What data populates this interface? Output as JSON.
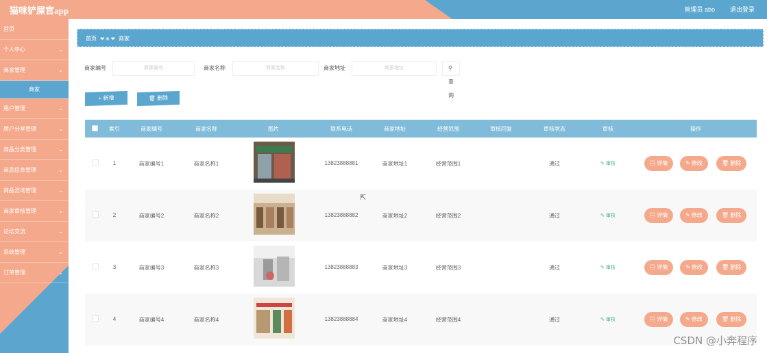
{
  "header": {
    "app_title": "猫咪铲屎官app",
    "user_info": "管理员 abo",
    "logout": "退出登录"
  },
  "sidebar": {
    "items": [
      {
        "label": "首页",
        "chevron": false
      },
      {
        "label": "个人中心",
        "chevron": true
      },
      {
        "label": "商家管理",
        "chevron": true
      },
      {
        "label": "商家",
        "sub": true
      },
      {
        "label": "用户管理",
        "chevron": true
      },
      {
        "label": "用户分享管理",
        "chevron": true
      },
      {
        "label": "商品分类管理",
        "chevron": true
      },
      {
        "label": "商品信息管理",
        "chevron": true
      },
      {
        "label": "商品咨询管理",
        "chevron": true
      },
      {
        "label": "商家审核管理",
        "chevron": true
      },
      {
        "label": "论坛交流",
        "chevron": true
      },
      {
        "label": "系统管理",
        "chevron": true
      },
      {
        "label": "订单管理",
        "chevron": true
      }
    ]
  },
  "breadcrumb": {
    "home": "首页",
    "current": "商家"
  },
  "search": {
    "merchant_no_label": "商家编号",
    "merchant_no_placeholder": "商家编号",
    "merchant_name_label": "商家名称",
    "merchant_name_placeholder": "商家名称",
    "merchant_addr_label": "商家地址",
    "merchant_addr_placeholder": "商家地址",
    "query_button": "查询"
  },
  "actions": {
    "add": "+ 新增",
    "delete": "删除"
  },
  "table": {
    "columns": [
      "索引",
      "商家编号",
      "商家名称",
      "图片",
      "联系电话",
      "商家地址",
      "经营范围",
      "审核回复",
      "审核状态",
      "审核",
      "操作"
    ],
    "rows": [
      {
        "index": "1",
        "no": "商家编号1",
        "name": "商家名称1",
        "phone": "13823888881",
        "addr": "商家地址1",
        "scope": "经营范围1",
        "reply": "",
        "status": "通过",
        "audit": "审核"
      },
      {
        "index": "2",
        "no": "商家编号2",
        "name": "商家名称2",
        "phone": "13823888882",
        "addr": "商家地址2",
        "scope": "经营范围2",
        "reply": "",
        "status": "通过",
        "audit": "审核"
      },
      {
        "index": "3",
        "no": "商家编号3",
        "name": "商家名称3",
        "phone": "13823888883",
        "addr": "商家地址3",
        "scope": "经营范围3",
        "reply": "",
        "status": "通过",
        "audit": "审核"
      },
      {
        "index": "4",
        "no": "商家编号4",
        "name": "商家名称4",
        "phone": "13823888884",
        "addr": "商家地址4",
        "scope": "经营范围4",
        "reply": "",
        "status": "通过",
        "audit": "审核"
      }
    ],
    "ops": {
      "detail": "详情",
      "edit": "修改",
      "delete": "删除"
    }
  },
  "watermark": "CSDN @小奔程序",
  "colors": {
    "peach": "#f5a98c",
    "blue": "#5ba6cf",
    "table_head": "#80bcd9"
  }
}
